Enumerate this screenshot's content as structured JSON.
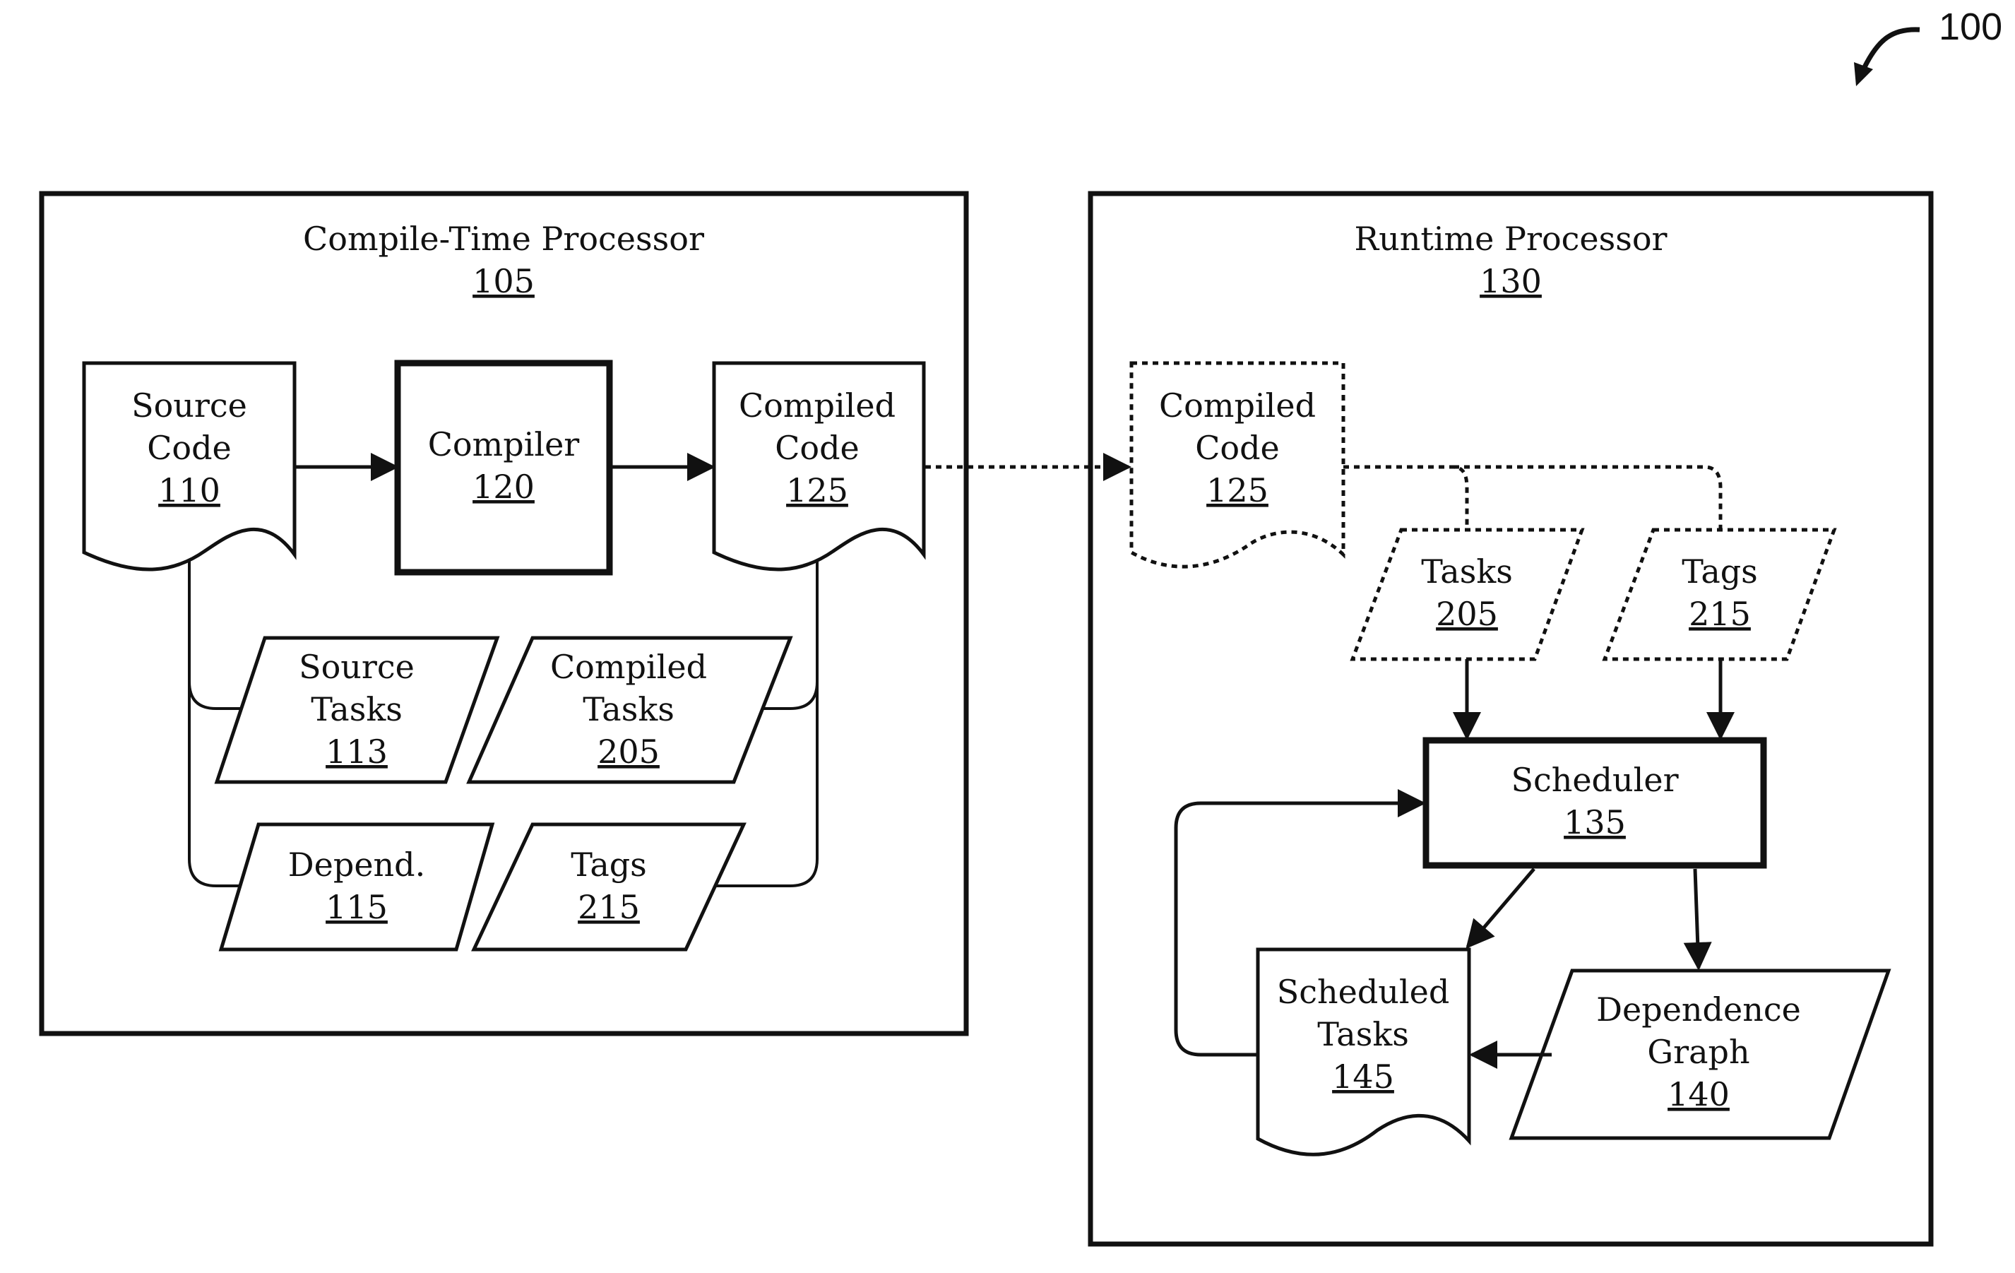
{
  "figure_ref": "100",
  "compile_time": {
    "title": "Compile-Time Processor",
    "ref": "105",
    "source_code": {
      "line1": "Source",
      "line2": "Code",
      "ref": "110"
    },
    "compiler": {
      "line1": "Compiler",
      "ref": "120"
    },
    "compiled_code": {
      "line1": "Compiled",
      "line2": "Code",
      "ref": "125"
    },
    "source_tasks": {
      "line1": "Source",
      "line2": "Tasks",
      "ref": "113"
    },
    "compiled_tasks": {
      "line1": "Compiled",
      "line2": "Tasks",
      "ref": "205"
    },
    "depend": {
      "line1": "Depend.",
      "ref": "115"
    },
    "tags": {
      "line1": "Tags",
      "ref": "215"
    }
  },
  "runtime": {
    "title": "Runtime Processor",
    "ref": "130",
    "compiled_code": {
      "line1": "Compiled",
      "line2": "Code",
      "ref": "125"
    },
    "tasks": {
      "line1": "Tasks",
      "ref": "205"
    },
    "tags": {
      "line1": "Tags",
      "ref": "215"
    },
    "scheduler": {
      "line1": "Scheduler",
      "ref": "135"
    },
    "scheduled_tasks": {
      "line1": "Scheduled",
      "line2": "Tasks",
      "ref": "145"
    },
    "dependence_graph": {
      "line1": "Dependence",
      "line2": "Graph",
      "ref": "140"
    }
  }
}
